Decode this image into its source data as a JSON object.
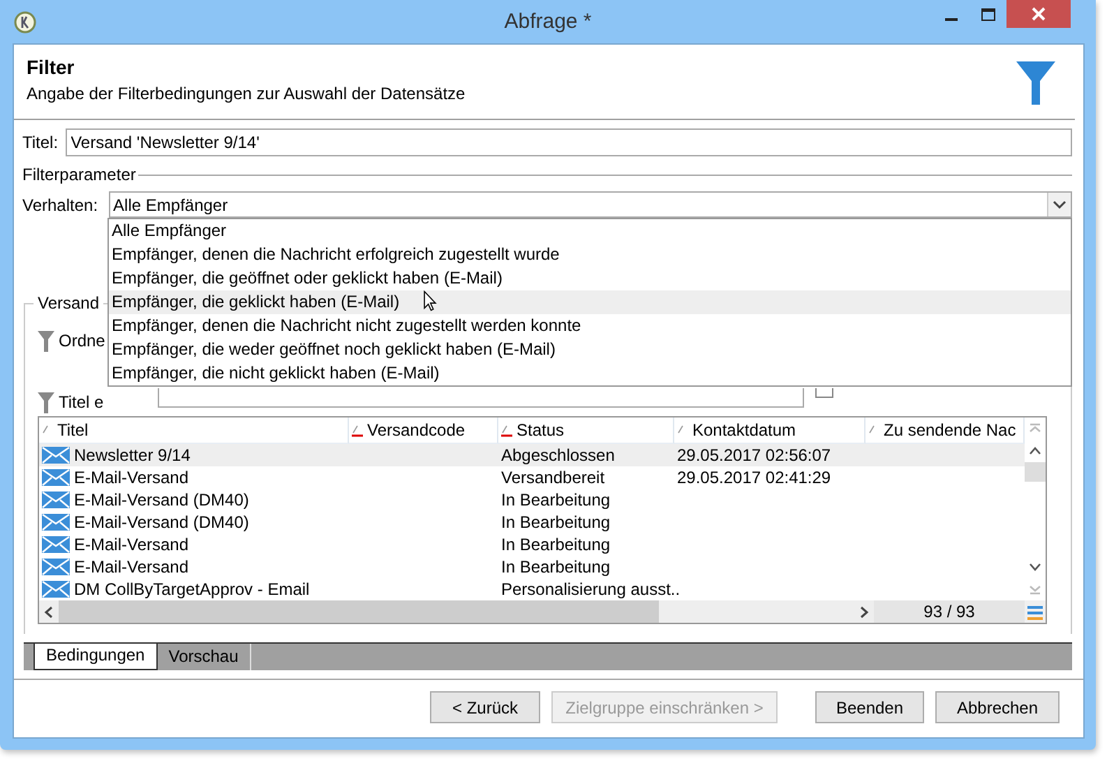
{
  "window": {
    "title": "Abfrage *"
  },
  "header": {
    "title": "Filter",
    "subtitle": "Angabe der Filterbedingungen zur Auswahl der Datensätze"
  },
  "title_field": {
    "label": "Titel:",
    "value": "Versand 'Newsletter 9/14'"
  },
  "filter_parameters": {
    "legend": "Filterparameter",
    "behavior": {
      "label": "Verhalten:",
      "value": "Alle Empfänger",
      "expanded": true,
      "options": [
        {
          "label": "Alle Empfänger",
          "highlighted": false
        },
        {
          "label": "Empfänger, denen die Nachricht erfolgreich zugestellt wurde",
          "highlighted": false
        },
        {
          "label": "Empfänger, die geöffnet oder geklickt haben (E-Mail)",
          "highlighted": false
        },
        {
          "label": "Empfänger, die geklickt haben (E-Mail)",
          "highlighted": true
        },
        {
          "label": "Empfänger, denen die Nachricht nicht zugestellt werden konnte",
          "highlighted": false
        },
        {
          "label": "Empfänger, die weder geöffnet noch geklickt haben (E-Mail)",
          "highlighted": false
        },
        {
          "label": "Empfänger, die nicht geklickt haben (E-Mail)",
          "highlighted": false
        }
      ]
    }
  },
  "delivery_group": {
    "legend": "Versand",
    "filters": [
      {
        "label": "Ordne"
      },
      {
        "label": "Titel e"
      }
    ],
    "checkbox": {
      "checked": false
    }
  },
  "table": {
    "columns": [
      {
        "label": "Titel",
        "sorted": false
      },
      {
        "label": "Versandcode",
        "sorted": true
      },
      {
        "label": "Status",
        "sorted": true
      },
      {
        "label": "Kontaktdatum",
        "sorted": false
      },
      {
        "label": "Zu sendende Nac",
        "sorted": false
      }
    ],
    "rows": [
      {
        "selected": true,
        "cells": [
          "Newsletter 9/14",
          "",
          "Abgeschlossen",
          "29.05.2017 02:56:07",
          ""
        ]
      },
      {
        "selected": false,
        "cells": [
          "E-Mail-Versand",
          "",
          "Versandbereit",
          "29.05.2017 02:41:29",
          ""
        ]
      },
      {
        "selected": false,
        "cells": [
          "E-Mail-Versand (DM40)",
          "",
          "In Bearbeitung",
          "",
          ""
        ]
      },
      {
        "selected": false,
        "cells": [
          "E-Mail-Versand (DM40)",
          "",
          "In Bearbeitung",
          "",
          ""
        ]
      },
      {
        "selected": false,
        "cells": [
          "E-Mail-Versand",
          "",
          "In Bearbeitung",
          "",
          ""
        ]
      },
      {
        "selected": false,
        "cells": [
          "E-Mail-Versand",
          "",
          "In Bearbeitung",
          "",
          ""
        ]
      },
      {
        "selected": false,
        "cells": [
          "DM CollByTargetApprov - Email",
          "",
          "Personalisierung ausst..",
          "",
          ""
        ]
      }
    ],
    "counter": "93 / 93"
  },
  "tabs": [
    {
      "label": "Bedingungen",
      "selected": true
    },
    {
      "label": "Vorschau",
      "selected": false
    }
  ],
  "buttons": [
    {
      "label": "< Zurück",
      "disabled": false
    },
    {
      "label": "Zielgruppe einschränken >",
      "disabled": true
    },
    {
      "label": "Beenden",
      "disabled": false
    },
    {
      "label": "Abbrechen",
      "disabled": false
    }
  ]
}
